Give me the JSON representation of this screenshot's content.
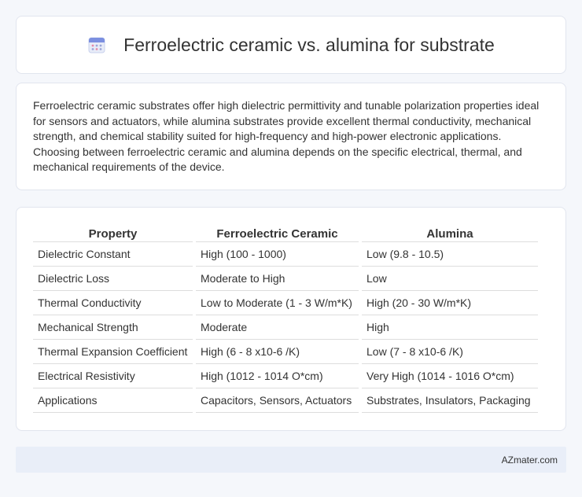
{
  "header": {
    "title": "Ferroelectric ceramic vs. alumina for substrate",
    "icon": "calendar-icon"
  },
  "description": "Ferroelectric ceramic substrates offer high dielectric permittivity and tunable polarization properties ideal for sensors and actuators, while alumina substrates provide excellent thermal conductivity, mechanical strength, and chemical stability suited for high-frequency and high-power electronic applications. Choosing between ferroelectric ceramic and alumina depends on the specific electrical, thermal, and mechanical requirements of the device.",
  "table": {
    "headers": [
      "Property",
      "Ferroelectric Ceramic",
      "Alumina"
    ],
    "rows": [
      [
        "Dielectric Constant",
        "High (100 - 1000)",
        "Low (9.8 - 10.5)"
      ],
      [
        "Dielectric Loss",
        "Moderate to High",
        "Low"
      ],
      [
        "Thermal Conductivity",
        "Low to Moderate (1 - 3 W/m*K)",
        "High (20 - 30 W/m*K)"
      ],
      [
        "Mechanical Strength",
        "Moderate",
        "High"
      ],
      [
        "Thermal Expansion Coefficient",
        "High (6 - 8 x10-6 /K)",
        "Low (7 - 8 x10-6 /K)"
      ],
      [
        "Electrical Resistivity",
        "High (1012 - 1014 O*cm)",
        "Very High (1014 - 1016 O*cm)"
      ],
      [
        "Applications",
        "Capacitors, Sensors, Actuators",
        "Substrates, Insulators, Packaging"
      ]
    ]
  },
  "footer": {
    "brand": "AZmater.com"
  }
}
